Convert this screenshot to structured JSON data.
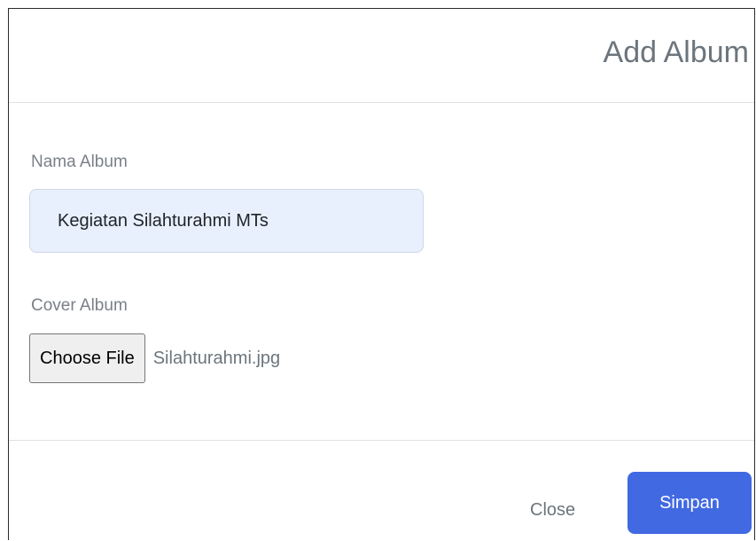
{
  "modal": {
    "title": "Add Album"
  },
  "form": {
    "nama_album": {
      "label": "Nama Album",
      "value": "Kegiatan Silahturahmi MTs"
    },
    "cover_album": {
      "label": "Cover Album",
      "button_label": "Choose File",
      "file_name": "Silahturahmi.jpg"
    }
  },
  "footer": {
    "close_label": "Close",
    "save_label": "Simpan"
  },
  "colors": {
    "primary": "#4169e1",
    "input_background": "#e8f0fe",
    "muted_text": "#6c757d",
    "divider": "#dee2e6"
  }
}
